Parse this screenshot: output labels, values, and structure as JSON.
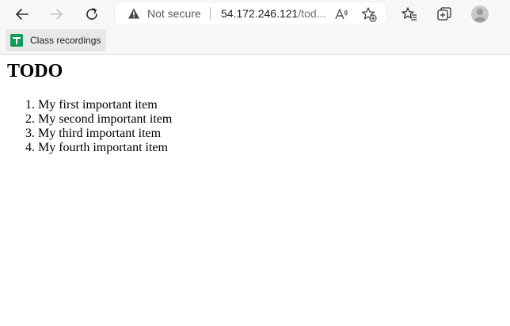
{
  "browser": {
    "address_bar": {
      "security_label": "Not secure",
      "url_host": "54.172.246.121",
      "url_rest": "/tod..."
    },
    "bookmarks": [
      {
        "label": "Class recordings",
        "icon": "google-sheets-icon"
      }
    ],
    "icons": {
      "back": "back-arrow-icon",
      "forward": "forward-arrow-icon",
      "refresh": "refresh-icon",
      "read_aloud": "read-aloud-icon",
      "add_favorite": "add-favorite-star-icon",
      "favorites": "favorites-icon",
      "collections": "collections-icon",
      "profile": "profile-avatar-icon"
    }
  },
  "page": {
    "title": "TODO",
    "items": [
      {
        "num": "1.",
        "text": "My first important item"
      },
      {
        "num": "2.",
        "text": "My second important item"
      },
      {
        "num": "3.",
        "text": "My third important item"
      },
      {
        "num": "4.",
        "text": "My fourth important item"
      }
    ]
  },
  "colors": {
    "toolbar_bg": "#f7f7f7",
    "page_bg": "#ffffff",
    "sheets_green": "#0f9d58"
  }
}
